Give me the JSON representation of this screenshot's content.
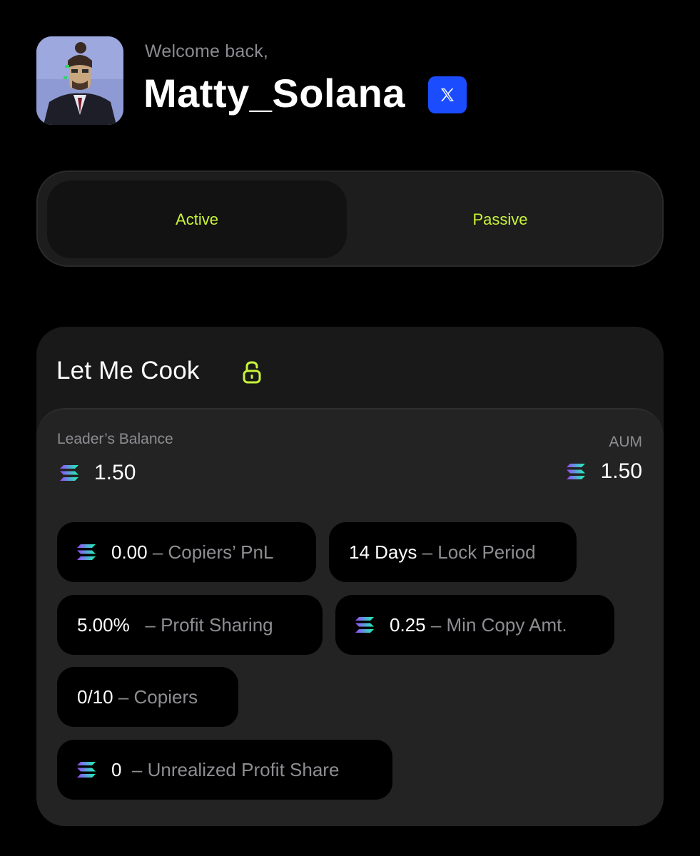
{
  "header": {
    "welcome": "Welcome back,",
    "username": "Matty_Solana",
    "x_badge_icon": "x-logo-icon"
  },
  "tabs": [
    {
      "label": "Active",
      "selected": true
    },
    {
      "label": "Passive",
      "selected": false
    }
  ],
  "card": {
    "title": "Let Me Cook",
    "lock_icon": "unlock-icon",
    "leader_balance_label": "Leader’s Balance",
    "leader_balance_value": "1.50",
    "aum_label": "AUM",
    "aum_value": "1.50",
    "stats": {
      "copiers_pnl": {
        "value": "0.00",
        "label": "– Copiers’ PnL"
      },
      "lock_period": {
        "value": "14 Days",
        "label": "– Lock Period"
      },
      "profit_sharing": {
        "value": "5.00%",
        "label": "– Profit Sharing"
      },
      "min_copy": {
        "value": "0.25",
        "label": "– Min Copy Amt."
      },
      "copiers": {
        "value": "0/10",
        "label": "– Copiers"
      },
      "unrealized": {
        "value": "0",
        "label": "– Unrealized Profit Share"
      }
    }
  },
  "colors": {
    "accent": "#c8f43a",
    "x_badge": "#1b4dff",
    "background": "#000000",
    "card": "#191919",
    "inner_card": "#232323"
  }
}
